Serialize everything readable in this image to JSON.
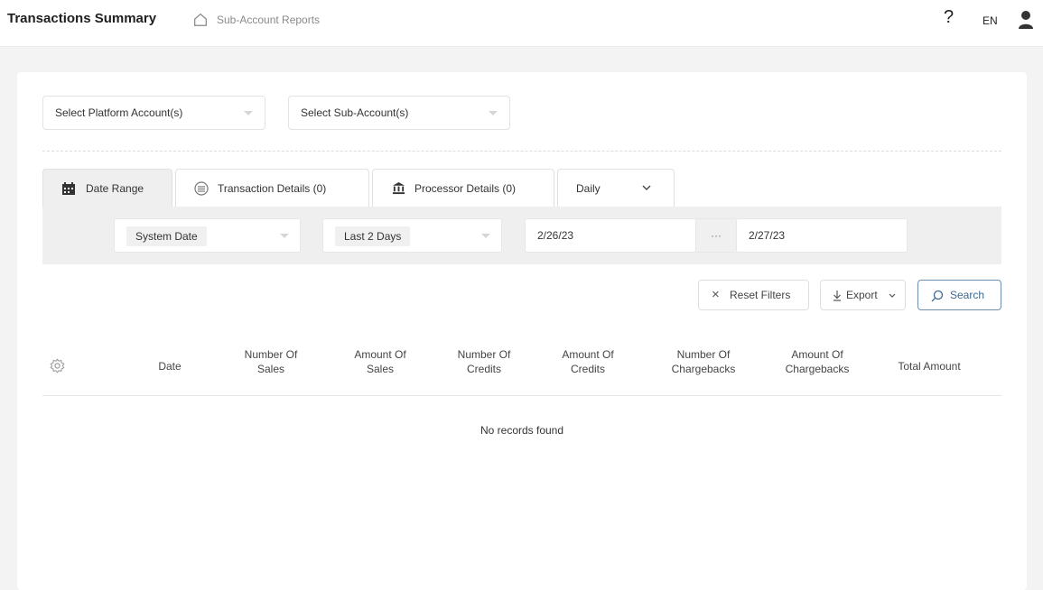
{
  "header": {
    "title": "Transactions Summary",
    "breadcrumb": "Sub-Account Reports",
    "help": "?",
    "language": "EN"
  },
  "filters": {
    "platform_account": "Select Platform Account(s)",
    "sub_account": "Select Sub-Account(s)"
  },
  "tabs": [
    {
      "label": "Date Range",
      "icon": "calendar-icon"
    },
    {
      "label": "Transaction Details (0)",
      "icon": "list-circle-icon"
    },
    {
      "label": "Processor Details (0)",
      "icon": "bank-icon"
    },
    {
      "label": "Daily",
      "icon": "chevron-down-icon"
    }
  ],
  "date_filter": {
    "date_type": "System Date",
    "range": "Last 2 Days",
    "from": "2/26/23",
    "separator": "···",
    "to": "2/27/23"
  },
  "actions": {
    "reset": "Reset Filters",
    "export": "Export",
    "search": "Search"
  },
  "table": {
    "columns": [
      "Date",
      "Number Of Sales",
      "Amount Of Sales",
      "Number Of Credits",
      "Amount Of Credits",
      "Number Of Chargebacks",
      "Amount Of Chargebacks",
      "Total Amount"
    ],
    "empty_message": "No records found"
  }
}
